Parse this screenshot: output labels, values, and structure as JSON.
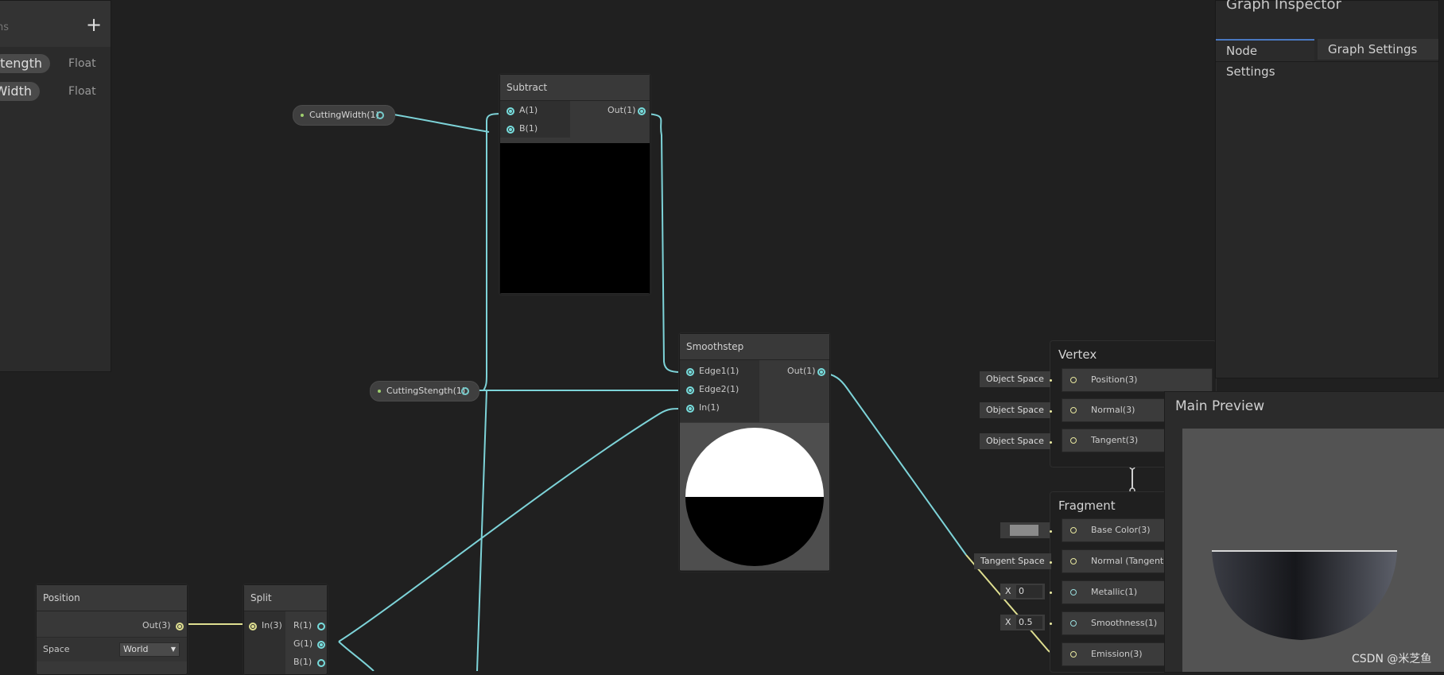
{
  "blackboard": {
    "subtitle": "ns",
    "add_label": "+",
    "properties": [
      {
        "name": "Stength",
        "type": "Float"
      },
      {
        "name": "Width",
        "type": "Float"
      }
    ]
  },
  "chips": {
    "cutting_width": "CuttingWidth(1)",
    "cutting_stength": "CuttingStength(1)"
  },
  "nodes": {
    "subtract": {
      "title": "Subtract",
      "in_a": "A(1)",
      "in_b": "B(1)",
      "out": "Out(1)"
    },
    "smoothstep": {
      "title": "Smoothstep",
      "edge1": "Edge1(1)",
      "edge2": "Edge2(1)",
      "in": "In(1)",
      "out": "Out(1)"
    },
    "position": {
      "title": "Position",
      "out": "Out(3)",
      "space_label": "Space",
      "space_value": "World"
    },
    "split": {
      "title": "Split",
      "in": "In(3)",
      "r": "R(1)",
      "g": "G(1)",
      "b": "B(1)"
    }
  },
  "vertex": {
    "title": "Vertex",
    "blocks": [
      {
        "tag": "Object Space",
        "label": "Position(3)"
      },
      {
        "tag": "Object Space",
        "label": "Normal(3)"
      },
      {
        "tag": "Object Space",
        "label": "Tangent(3)"
      }
    ]
  },
  "fragment": {
    "title": "Fragment",
    "base_color": "Base Color(3)",
    "normal_tag": "Tangent Space",
    "normal": "Normal (Tangent Spac",
    "metallic_axis": "X",
    "metallic_value": "0",
    "metallic": "Metallic(1)",
    "smoothness_axis": "X",
    "smoothness_value": "0.5",
    "smoothness": "Smoothness(1)",
    "emission": "Emission(3)",
    "base_color_swatch": "#8a8a8a"
  },
  "inspector": {
    "title": "Graph Inspector",
    "tabs": [
      "Node Settings",
      "Graph Settings"
    ],
    "active_tab": "Node Settings"
  },
  "main_preview": {
    "title": "Main Preview"
  },
  "watermark": "CSDN @米芝鱼",
  "colors": {
    "wire_cyan": "#7dd3d8",
    "wire_yellow": "#dede90",
    "tab_accent": "#4a78c0"
  }
}
